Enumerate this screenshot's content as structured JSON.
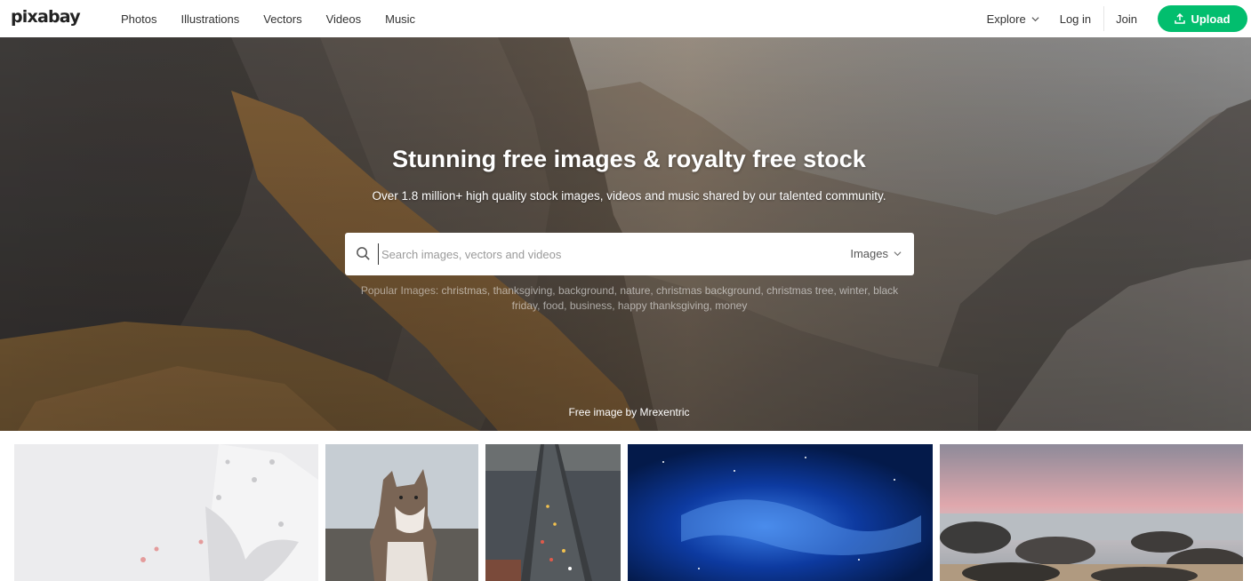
{
  "header": {
    "logo": "pixabay",
    "nav": [
      "Photos",
      "Illustrations",
      "Vectors",
      "Videos",
      "Music"
    ],
    "explore": "Explore",
    "login": "Log in",
    "join": "Join",
    "upload": "Upload"
  },
  "hero": {
    "title": "Stunning free images & royalty free stock",
    "subtitle": "Over 1.8 million+ high quality stock images, videos and music shared by our talented community.",
    "search": {
      "placeholder": "Search images, vectors and videos",
      "value": "",
      "type": "Images"
    },
    "popular_label": "Popular Images:",
    "popular_tags": [
      "christmas",
      "thanksgiving",
      "background",
      "nature",
      "christmas background",
      "christmas tree",
      "winter",
      "black friday",
      "food",
      "business",
      "happy thanksgiving",
      "money"
    ],
    "credit_prefix": "Free image by",
    "credit_author": "Mrexentric"
  },
  "gallery": [
    {
      "subject": "white ribbon with stars"
    },
    {
      "subject": "dog"
    },
    {
      "subject": "bridge with traffic"
    },
    {
      "subject": "blue starry sky"
    },
    {
      "subject": "rocky beach at sunset"
    }
  ],
  "colors": {
    "accent": "#02be6e",
    "text": "#333333"
  }
}
